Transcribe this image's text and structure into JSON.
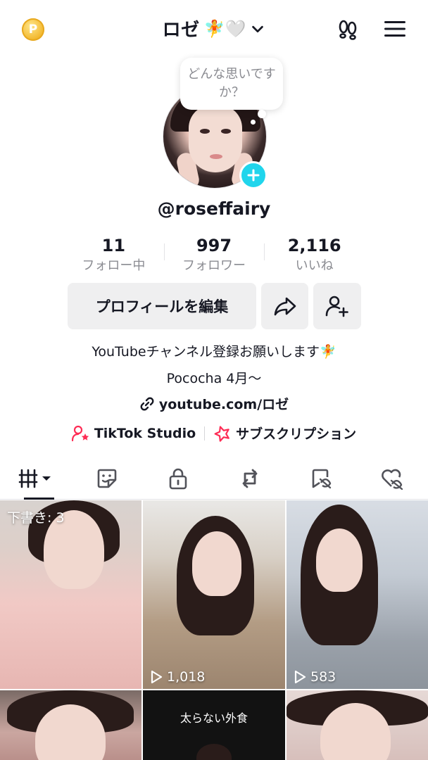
{
  "header": {
    "coin_label": "P",
    "username_title": "ロゼ",
    "title_emoji": "🧚🤍"
  },
  "bubble": {
    "text": "どんな思いですか？"
  },
  "profile": {
    "handle": "@roseffairy"
  },
  "stats": [
    {
      "value": "11",
      "label": "フォロー中"
    },
    {
      "value": "997",
      "label": "フォロワー"
    },
    {
      "value": "2,116",
      "label": "いいね"
    }
  ],
  "actions": {
    "edit_profile": "プロフィールを編集"
  },
  "bio": {
    "line1": "YouTubeチャンネル登録お願いします🧚",
    "line2": "Pococha 4月〜",
    "link": "youtube.com/ロゼ"
  },
  "extras": {
    "studio": "TikTok Studio",
    "subscription": "サブスクリプション"
  },
  "grid": {
    "draft_label": "下書き: 3",
    "views": [
      "1,018",
      "583"
    ],
    "overlay_text": "太らない外食"
  },
  "colors": {
    "accent_plus": "#20d5ec",
    "studio_icon": "#fe2c55"
  }
}
